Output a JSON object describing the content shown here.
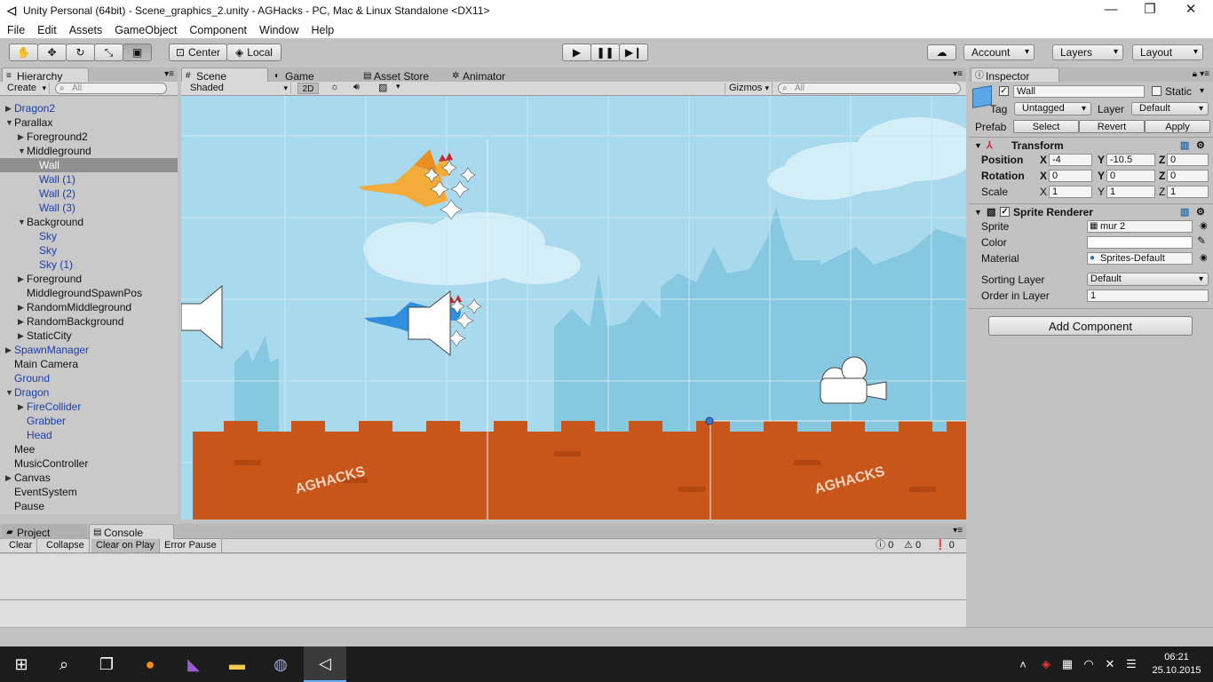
{
  "window": {
    "title": "Unity Personal (64bit) - Scene_graphics_2.unity - AGHacks - PC, Mac & Linux Standalone <DX11>",
    "minimize": "—",
    "restore": "❐",
    "close": "✕"
  },
  "menu": [
    "File",
    "Edit",
    "Assets",
    "GameObject",
    "Component",
    "Window",
    "Help"
  ],
  "toolbar": {
    "tools": [
      "hand-icon",
      "move-icon",
      "rotate-icon",
      "scale-icon",
      "rect-icon"
    ],
    "pivot": "Center",
    "space": "Local",
    "account": "Account",
    "layers": "Layers",
    "layout": "Layout"
  },
  "hierarchy": {
    "tab": "Hierarchy",
    "create": "Create",
    "search_placeholder": "All",
    "items": [
      {
        "label": "Dragon2",
        "blue": true,
        "arrow": "right",
        "indent": 0
      },
      {
        "label": "Parallax",
        "blue": false,
        "arrow": "down",
        "indent": 0
      },
      {
        "label": "Foreground2",
        "blue": false,
        "arrow": "right",
        "indent": 1
      },
      {
        "label": "Middleground",
        "blue": false,
        "arrow": "down",
        "indent": 1
      },
      {
        "label": "Wall",
        "blue": true,
        "arrow": "",
        "indent": 2,
        "selected": true
      },
      {
        "label": "Wall (1)",
        "blue": true,
        "arrow": "",
        "indent": 2
      },
      {
        "label": "Wall (2)",
        "blue": true,
        "arrow": "",
        "indent": 2
      },
      {
        "label": "Wall (3)",
        "blue": true,
        "arrow": "",
        "indent": 2
      },
      {
        "label": "Background",
        "blue": false,
        "arrow": "down",
        "indent": 1
      },
      {
        "label": "Sky",
        "blue": true,
        "arrow": "",
        "indent": 2
      },
      {
        "label": "Sky",
        "blue": true,
        "arrow": "",
        "indent": 2
      },
      {
        "label": "Sky (1)",
        "blue": true,
        "arrow": "",
        "indent": 2
      },
      {
        "label": "Foreground",
        "blue": false,
        "arrow": "right",
        "indent": 1
      },
      {
        "label": "MiddlegroundSpawnPos",
        "blue": false,
        "arrow": "",
        "indent": 1
      },
      {
        "label": "RandomMiddleground",
        "blue": false,
        "arrow": "right",
        "indent": 1
      },
      {
        "label": "RandomBackground",
        "blue": false,
        "arrow": "right",
        "indent": 1
      },
      {
        "label": "StaticCity",
        "blue": false,
        "arrow": "right",
        "indent": 1
      },
      {
        "label": "SpawnManager",
        "blue": true,
        "arrow": "right",
        "indent": 0
      },
      {
        "label": "Main Camera",
        "blue": false,
        "arrow": "",
        "indent": 0
      },
      {
        "label": "Ground",
        "blue": true,
        "arrow": "",
        "indent": 0
      },
      {
        "label": "Dragon",
        "blue": true,
        "arrow": "down",
        "indent": 0
      },
      {
        "label": "FireCollider",
        "blue": true,
        "arrow": "right",
        "indent": 1
      },
      {
        "label": "Grabber",
        "blue": true,
        "arrow": "",
        "indent": 1
      },
      {
        "label": "Head",
        "blue": true,
        "arrow": "",
        "indent": 1
      },
      {
        "label": "Mee",
        "blue": false,
        "arrow": "",
        "indent": 0
      },
      {
        "label": "MusicController",
        "blue": false,
        "arrow": "",
        "indent": 0
      },
      {
        "label": "Canvas",
        "blue": false,
        "arrow": "right",
        "indent": 0
      },
      {
        "label": "EventSystem",
        "blue": false,
        "arrow": "",
        "indent": 0
      },
      {
        "label": "Pause",
        "blue": false,
        "arrow": "",
        "indent": 0
      }
    ]
  },
  "scene_tabs": {
    "scene": "Scene",
    "game": "Game",
    "asset_store": "Asset Store",
    "animator": "Animator"
  },
  "scene_bar": {
    "shading": "Shaded",
    "mode2d": "2D",
    "gizmos": "Gizmos",
    "search_placeholder": "All",
    "watermark": "AGHACKS"
  },
  "inspector": {
    "tab": "Inspector",
    "object_name": "Wall",
    "static_label": "Static",
    "tag_label": "Tag",
    "tag_value": "Untagged",
    "layer_label": "Layer",
    "layer_value": "Default",
    "prefab_label": "Prefab",
    "prefab_select": "Select",
    "prefab_revert": "Revert",
    "prefab_apply": "Apply",
    "transform": {
      "title": "Transform",
      "position_label": "Position",
      "rotation_label": "Rotation",
      "scale_label": "Scale",
      "x": "X",
      "y": "Y",
      "z": "Z",
      "position": [
        "-4",
        "-10.5",
        "0"
      ],
      "rotation": [
        "0",
        "0",
        "0"
      ],
      "scale": [
        "1",
        "1",
        "1"
      ]
    },
    "sprite_renderer": {
      "title": "Sprite Renderer",
      "sprite_label": "Sprite",
      "sprite_value": "mur 2",
      "color_label": "Color",
      "material_label": "Material",
      "material_value": "Sprites-Default",
      "sorting_label": "Sorting Layer",
      "sorting_value": "Default",
      "order_label": "Order in Layer",
      "order_value": "1"
    },
    "add_component": "Add Component"
  },
  "console": {
    "project_tab": "Project",
    "console_tab": "Console",
    "buttons": [
      "Clear",
      "Collapse",
      "Clear on Play",
      "Error Pause"
    ],
    "info_count": "0",
    "warn_count": "0",
    "error_count": "0"
  },
  "taskbar": {
    "time": "06:21",
    "date": "25.10.2015"
  },
  "colors": {
    "sky": "#a9d9ec",
    "wall": "#c8561a",
    "city": "#86c8e0"
  }
}
